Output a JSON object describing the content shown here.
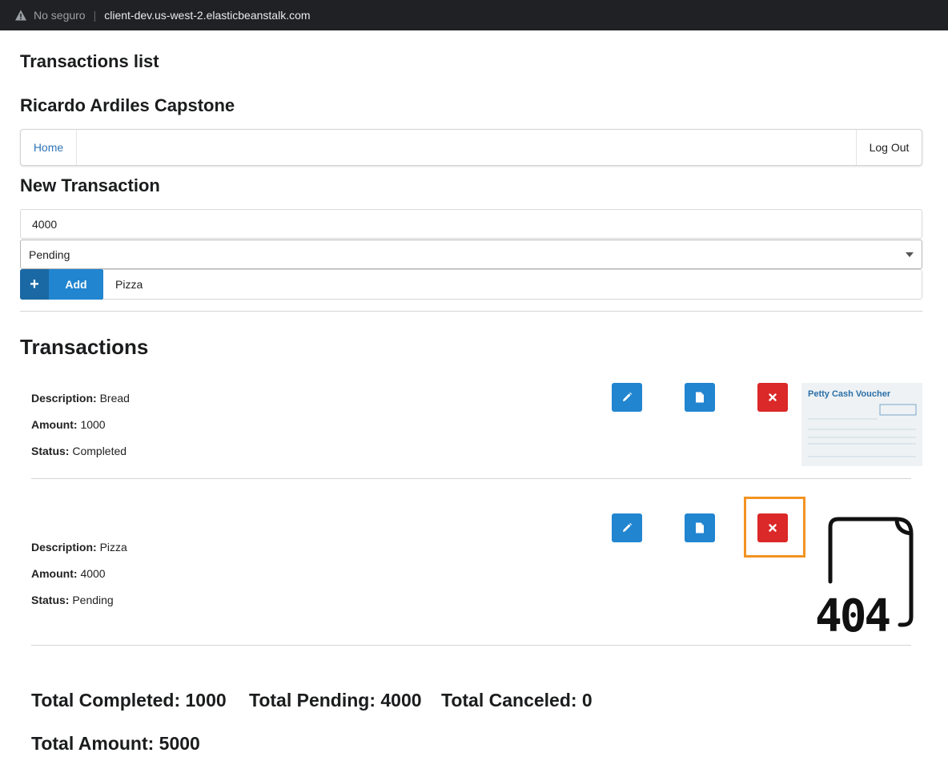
{
  "browser": {
    "security_label": "No seguro",
    "url": "client-dev.us-west-2.elasticbeanstalk.com"
  },
  "page": {
    "title": "Transactions list",
    "subtitle": "Ricardo Ardiles Capstone"
  },
  "menu": {
    "home": "Home",
    "logout": "Log Out"
  },
  "new_transaction": {
    "heading": "New Transaction",
    "amount_value": "4000",
    "status_value": "Pending",
    "add_label": "Add",
    "add_icon": "+",
    "description_value": "Pizza"
  },
  "transactions": {
    "heading": "Transactions",
    "labels": {
      "description": "Description:",
      "amount": "Amount:",
      "status": "Status:"
    },
    "items": [
      {
        "description": "Bread",
        "amount": "1000",
        "status": "Completed",
        "attachment_title": "Petty Cash Voucher",
        "attachment": "petty-cash-voucher-image"
      },
      {
        "description": "Pizza",
        "amount": "4000",
        "status": "Pending",
        "attachment_title": "404",
        "attachment": "file-not-found-404-image"
      }
    ]
  },
  "totals": {
    "completed": "Total Completed: 1000",
    "pending": "Total Pending: 4000",
    "canceled": "Total Canceled: 0",
    "amount": "Total Amount: 5000"
  },
  "colors": {
    "primary": "#2185d0",
    "danger": "#db2828",
    "highlight": "#f39322",
    "link": "#2f75b5"
  },
  "icons": {
    "edit": "pencil-icon",
    "attach": "file-icon",
    "delete": "close-icon",
    "add": "plus-icon",
    "warning": "warning-icon"
  }
}
